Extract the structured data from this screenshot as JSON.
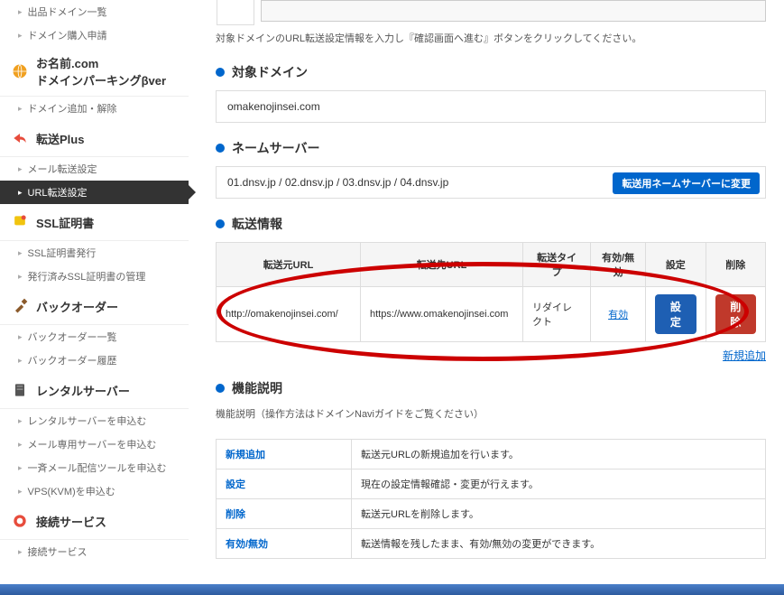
{
  "sidebar": {
    "items0": [
      "出品ドメイン一覧",
      "ドメイン購入申請"
    ],
    "group_onamae": {
      "line1": "お名前.com",
      "line2": "ドメインパーキングβver"
    },
    "items1": [
      "ドメイン追加・解除"
    ],
    "group_tensou": "転送Plus",
    "items2": [
      "メール転送設定",
      "URL転送設定"
    ],
    "group_ssl": "SSL証明書",
    "items3": [
      "SSL証明書発行",
      "発行済みSSL証明書の管理"
    ],
    "group_back": "バックオーダー",
    "items4": [
      "バックオーダー一覧",
      "バックオーダー履歴"
    ],
    "group_rental": "レンタルサーバー",
    "items5": [
      "レンタルサーバーを申込む",
      "メール専用サーバーを申込む",
      "一斉メール配信ツールを申込む",
      "VPS(KVM)を申込む"
    ],
    "group_conn": "接続サービス",
    "items6": [
      "接続サービス"
    ]
  },
  "main": {
    "instruction": "対象ドメインのURL転送設定情報を入力し『確認画面へ進む』ボタンをクリックしてください。",
    "sec_domain": "対象ドメイン",
    "domain_value": "omakenojinsei.com",
    "sec_ns": "ネームサーバー",
    "ns_value": "01.dnsv.jp / 02.dnsv.jp / 03.dnsv.jp / 04.dnsv.jp",
    "ns_change_btn": "転送用ネームサーバーに変更",
    "sec_info": "転送情報",
    "table": {
      "headers": [
        "転送元URL",
        "転送先URL",
        "転送タイプ",
        "有効/無効",
        "設定",
        "削除"
      ],
      "row": {
        "src": "http://omakenojinsei.com/",
        "dst": "https://www.omakenojinsei.com",
        "type": "リダイレクト",
        "status": "有効",
        "setbtn": "設定",
        "delbtn": "削除"
      }
    },
    "add_link": "新規追加",
    "sec_func": "機能説明",
    "func_note": "機能説明（操作方法はドメインNaviガイドをご覧ください）",
    "func_rows": [
      {
        "k": "新規追加",
        "v": "転送元URLの新規追加を行います。"
      },
      {
        "k": "設定",
        "v": "現在の設定情報確認・変更が行えます。"
      },
      {
        "k": "削除",
        "v": "転送元URLを削除します。"
      },
      {
        "k": "有効/無効",
        "v": "転送情報を残したまま、有効/無効の変更ができます。"
      }
    ]
  }
}
